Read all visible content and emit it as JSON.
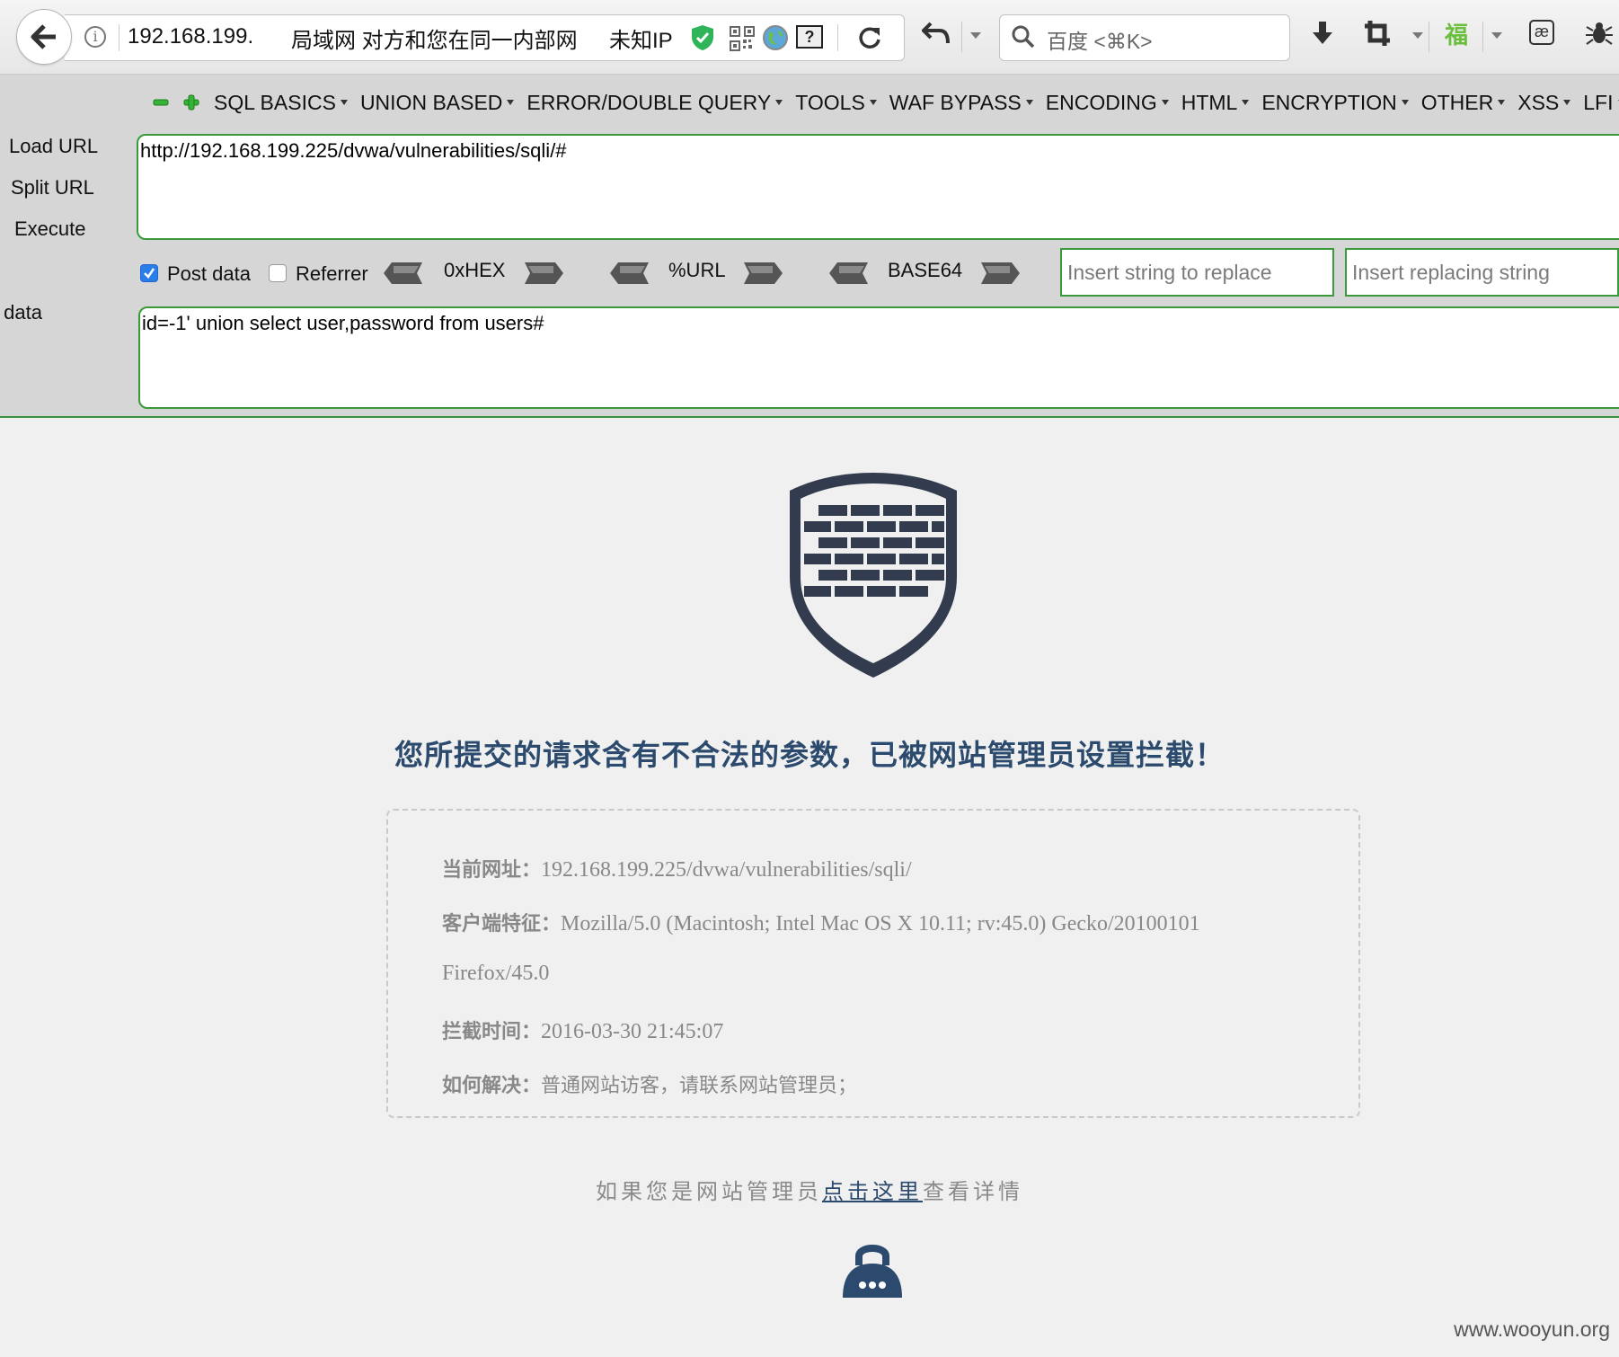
{
  "browser": {
    "address": "192.168.199.",
    "network_label": "局域网 对方和您在同一内部网",
    "ip_label": "未知IP",
    "search_placeholder": "百度 <⌘K>"
  },
  "hackbar": {
    "menu": [
      "SQL BASICS",
      "UNION BASED",
      "ERROR/DOUBLE QUERY",
      "TOOLS",
      "WAF BYPASS",
      "ENCODING",
      "HTML",
      "ENCRYPTION",
      "OTHER",
      "XSS",
      "LFI"
    ],
    "side": {
      "load_url": "Load URL",
      "split_url": "Split URL",
      "execute": "Execute",
      "post_data": "data"
    },
    "url_value": "http://192.168.199.225/dvwa/vulnerabilities/sqli/#",
    "post_checkbox": {
      "label": "Post data",
      "checked": true
    },
    "referrer_checkbox": {
      "label": "Referrer",
      "checked": false
    },
    "encoders": [
      "0xHEX",
      "%URL",
      "BASE64"
    ],
    "replace_placeholder": "Insert string to replace",
    "replacing_placeholder": "Insert replacing string",
    "post_value": "id=-1' union select user,password from users#"
  },
  "block_page": {
    "title": "您所提交的请求含有不合法的参数，已被网站管理员设置拦截！",
    "rows": [
      {
        "label": "当前网址：",
        "value": "192.168.199.225/dvwa/vulnerabilities/sqli/"
      },
      {
        "label": "客户端特征：",
        "value": "Mozilla/5.0 (Macintosh; Intel Mac OS X 10.11; rv:45.0) Gecko/20100101"
      },
      {
        "label": "",
        "value": "Firefox/45.0"
      },
      {
        "label": "拦截时间：",
        "value": "2016-03-30 21:45:07"
      },
      {
        "label": "如何解决：",
        "value": "普通网站访客，请联系网站管理员；"
      }
    ],
    "admin_prefix": "如果您是网站管理员",
    "admin_link": "点击这里",
    "admin_suffix": "查看详情"
  },
  "watermark": "www.wooyun.org",
  "colors": {
    "accent_green": "#3a9a3a",
    "title_blue": "#2b4a6d",
    "shield": "#333c4e"
  }
}
